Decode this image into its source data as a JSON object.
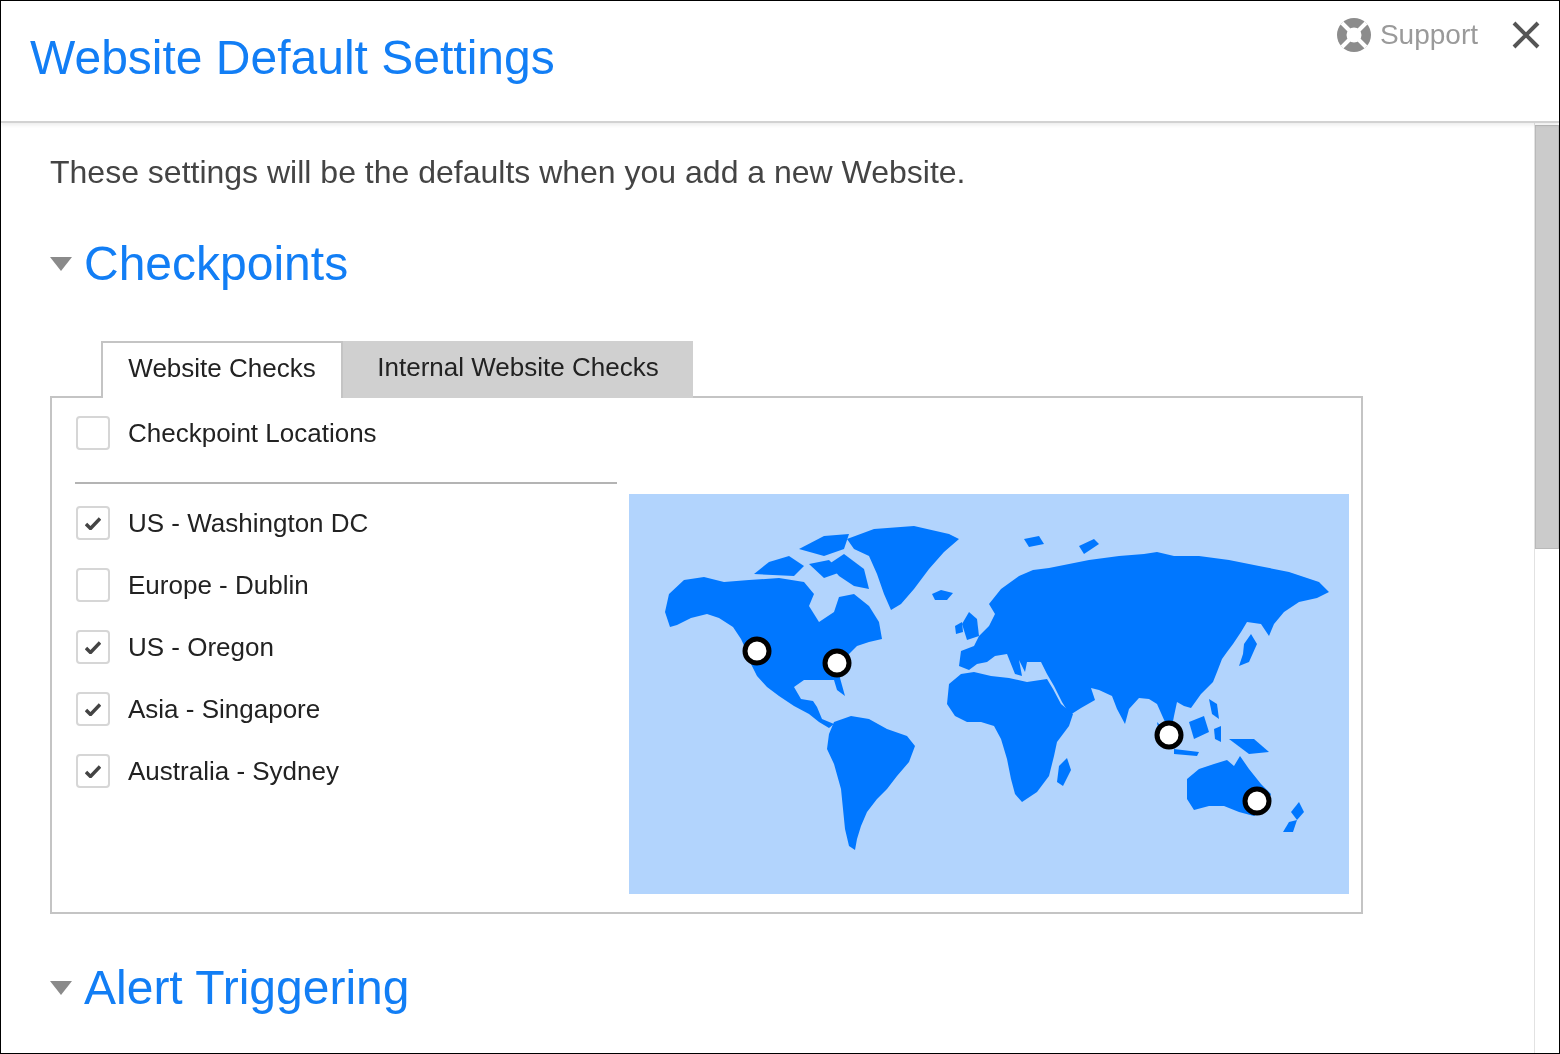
{
  "window": {
    "title": "Website Default Settings"
  },
  "header": {
    "support_link": "Support"
  },
  "description": "These settings will be the defaults when you add a new Website.",
  "sections": [
    {
      "title": "Checkpoints",
      "expanded": true,
      "tabs": [
        {
          "label": "Website Checks",
          "selected": true
        },
        {
          "label": "Internal Website Checks",
          "selected": false
        }
      ],
      "select_all": {
        "label": "Checkpoint Locations",
        "checked": false
      },
      "locations": [
        {
          "label": "US - Washington DC",
          "checked": true
        },
        {
          "label": "Europe - Dublin",
          "checked": false
        },
        {
          "label": "US - Oregon",
          "checked": true
        },
        {
          "label": "Asia - Singapore",
          "checked": true
        },
        {
          "label": "Australia - Sydney",
          "checked": true
        }
      ]
    },
    {
      "title": "Alert Triggering",
      "expanded": true
    }
  ]
}
